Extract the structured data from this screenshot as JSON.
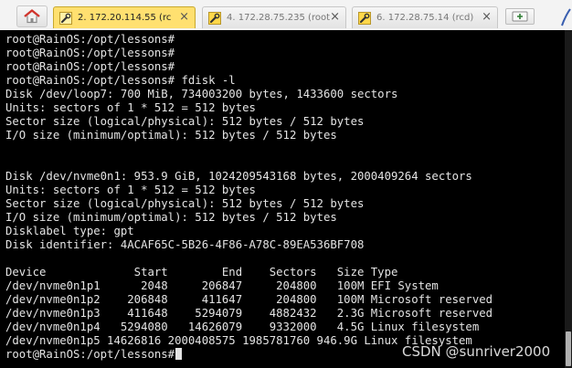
{
  "tabs": [
    {
      "label": "2. 172.20.114.55 (rc",
      "state": "active"
    },
    {
      "label": "4. 172.28.75.235 (root",
      "state": "inactive"
    },
    {
      "label": "6. 172.28.75.14 (rcd)",
      "state": "inactive"
    }
  ],
  "icons": {
    "home": "home-icon",
    "tab": "wrench-icon",
    "close": "close-icon",
    "new_tab": "new-tab-icon"
  },
  "colors": {
    "terminal_bg": "#000000",
    "terminal_fg": "#e4e4e4",
    "active_tab": "#ffe070"
  },
  "terminal": {
    "lines": [
      "root@RainOS:/opt/lessons#",
      "root@RainOS:/opt/lessons#",
      "root@RainOS:/opt/lessons#",
      "root@RainOS:/opt/lessons# fdisk -l",
      "Disk /dev/loop7: 700 MiB, 734003200 bytes, 1433600 sectors",
      "Units: sectors of 1 * 512 = 512 bytes",
      "Sector size (logical/physical): 512 bytes / 512 bytes",
      "I/O size (minimum/optimal): 512 bytes / 512 bytes",
      "",
      "",
      "Disk /dev/nvme0n1: 953.9 GiB, 1024209543168 bytes, 2000409264 sectors",
      "Units: sectors of 1 * 512 = 512 bytes",
      "Sector size (logical/physical): 512 bytes / 512 bytes",
      "I/O size (minimum/optimal): 512 bytes / 512 bytes",
      "Disklabel type: gpt",
      "Disk identifier: 4ACAF65C-5B26-4F86-A78C-89EA536BF708",
      "",
      "Device             Start        End    Sectors   Size Type",
      "/dev/nvme0n1p1      2048     206847     204800   100M EFI System",
      "/dev/nvme0n1p2    206848     411647     204800   100M Microsoft reserved",
      "/dev/nvme0n1p3    411648    5294079    4882432   2.3G Microsoft reserved",
      "/dev/nvme0n1p4   5294080   14626079    9332000   4.5G Linux filesystem",
      "/dev/nvme0n1p5 14626816 2000408575 1985781760 946.9G Linux filesystem"
    ],
    "prompt": "root@RainOS:/opt/lessons#"
  },
  "watermark": "CSDN @sunriver2000"
}
